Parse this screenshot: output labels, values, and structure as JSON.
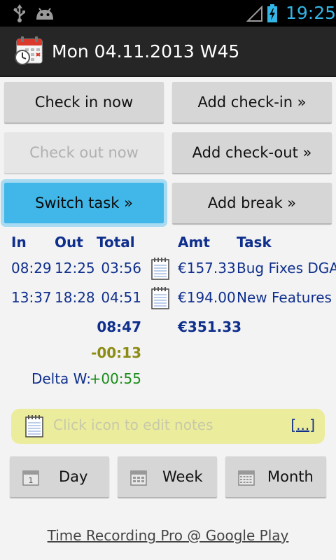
{
  "status_bar": {
    "time": "19:25",
    "time_color": "#33b5e5",
    "icons": [
      "usb-icon",
      "android-icon",
      "signal-icon",
      "battery-charging-icon"
    ]
  },
  "header": {
    "title": "Mon 04.11.2013 W45",
    "icon": "calendar-clock-icon"
  },
  "actions": {
    "check_in_now": "Check in now",
    "add_check_in": "Add check-in »",
    "check_out_now": "Check out now",
    "add_check_out": "Add check-out »",
    "switch_task": "Switch task »",
    "add_break": "Add break »"
  },
  "table": {
    "headers": {
      "in": "In",
      "out": "Out",
      "total": "Total",
      "amt": "Amt",
      "task": "Task"
    },
    "rows": [
      {
        "in": "08:29",
        "out": "12:25",
        "total": "03:56",
        "amt": "€157.33",
        "task": "Bug Fixes DGA"
      },
      {
        "in": "13:37",
        "out": "18:28",
        "total": "04:51",
        "amt": "€194.00",
        "task": "New Features"
      }
    ],
    "sum_total": "08:47",
    "sum_amt": "€351.33",
    "diff": "-00:13",
    "delta_label": "Delta W:",
    "delta_value": "+00:55"
  },
  "notes": {
    "placeholder": "Click icon to edit notes",
    "more": "[...]",
    "icon": "notepad-icon"
  },
  "navigation": {
    "day": "Day",
    "week": "Week",
    "month": "Month"
  },
  "footer": {
    "link": "Time Recording Pro @ Google Play"
  },
  "colors": {
    "accent": "#33b5e5",
    "table_text": "#0f2f8c",
    "focused_button": "#40b7e8",
    "notes_bg": "#ebec9c",
    "positive": "#1a8c1a",
    "warning": "#8c8c14"
  }
}
